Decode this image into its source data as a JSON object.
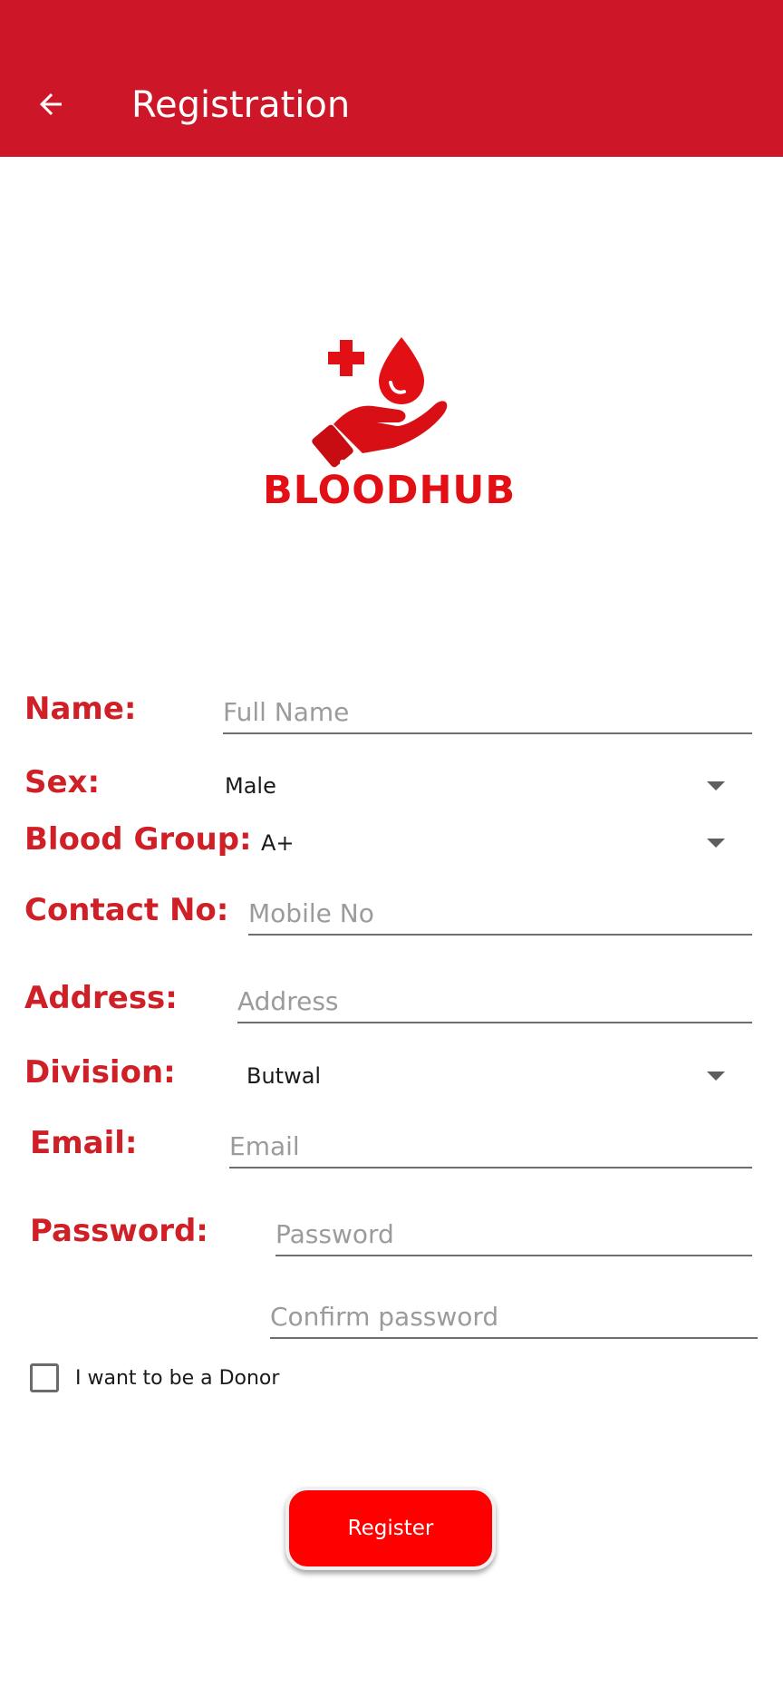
{
  "appbar": {
    "title": "Registration",
    "back_icon": "arrow-left-icon"
  },
  "logo": {
    "text": "BLOODHUB",
    "icon": "blood-donation-hand-icon",
    "color": "#e20f14"
  },
  "form": {
    "name_label": "Name:",
    "name_placeholder": "Full Name",
    "sex_label": "Sex:",
    "sex_value": "Male",
    "blood_group_label": "Blood Group:",
    "blood_group_value": "A+",
    "contact_label": "Contact No:",
    "contact_placeholder": "Mobile No",
    "address_label": "Address:",
    "address_placeholder": "Address",
    "division_label": "Division:",
    "division_value": "Butwal",
    "email_label": "Email:",
    "email_placeholder": "Email",
    "password_label": "Password:",
    "password_placeholder": "Password",
    "confirm_placeholder": "Confirm password",
    "donor_checkbox_label": "I want to be a Donor",
    "register_label": "Register"
  },
  "colors": {
    "appbar": "#cd1628",
    "label": "#cf2027",
    "button": "#ff0000"
  }
}
